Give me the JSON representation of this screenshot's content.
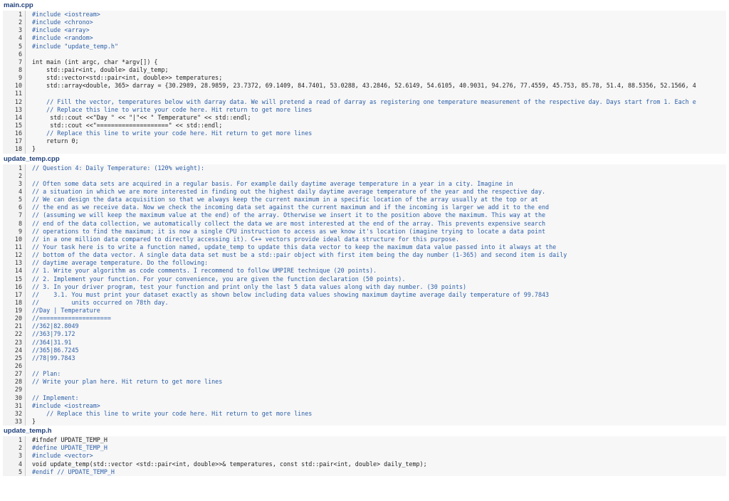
{
  "files": [
    {
      "name": "main.cpp",
      "lines": [
        {
          "n": "1",
          "text": "#include <iostream>",
          "kind": "pp"
        },
        {
          "n": "2",
          "text": "#include <chrono>",
          "kind": "pp"
        },
        {
          "n": "3",
          "text": "#include <array>",
          "kind": "pp"
        },
        {
          "n": "4",
          "text": "#include <random>",
          "kind": "pp"
        },
        {
          "n": "5",
          "text": "#include \"update_temp.h\"",
          "kind": "pp"
        },
        {
          "n": "6",
          "text": "",
          "kind": "plain"
        },
        {
          "n": "7",
          "text": "int main (int argc, char *argv[]) {",
          "kind": "plain"
        },
        {
          "n": "8",
          "text": "    std::pair<int, double> daily_temp;",
          "kind": "plain"
        },
        {
          "n": "9",
          "text": "    std::vector<std::pair<int, double>> temperatures;",
          "kind": "plain"
        },
        {
          "n": "10",
          "text": "    std::array<double, 365> darray = {30.2989, 28.9859, 23.7372, 69.1409, 84.7401, 53.0288, 43.2846, 52.6149, 54.6105, 40.9031, 94.276, 77.4559, 45.753, 85.78, 51.4, 88.5356, 52.1566, 4",
          "kind": "plain"
        },
        {
          "n": "11",
          "text": "",
          "kind": "plain"
        },
        {
          "n": "12",
          "text": "    // Fill the vector, temperatures below with darray data. We will pretend a read of darray as registering one temperature measurement of the respective day. Days start from 1. Each e",
          "kind": "cmt"
        },
        {
          "n": "13",
          "text": "    // Replace this line to write your code here. Hit return to get more lines",
          "kind": "cmt"
        },
        {
          "n": "14",
          "text": "     std::cout <<\"Day \" << \"|\"<< \" Temperature\" << std::endl;",
          "kind": "plain"
        },
        {
          "n": "15",
          "text": "     std::cout <<\"====================\" << std::endl;",
          "kind": "plain"
        },
        {
          "n": "16",
          "text": "    // Replace this line to write your code here. Hit return to get more lines",
          "kind": "cmt"
        },
        {
          "n": "17",
          "text": "    return 0;",
          "kind": "plain"
        },
        {
          "n": "18",
          "text": "}",
          "kind": "plain"
        }
      ]
    },
    {
      "name": "update_temp.cpp",
      "lines": [
        {
          "n": "1",
          "text": "// Question 4: Daily Temperature: (120% weight):",
          "kind": "cmt"
        },
        {
          "n": "2",
          "text": "",
          "kind": "plain"
        },
        {
          "n": "3",
          "text": "// Often some data sets are acquired in a regular basis. For example daily daytime average temperature in a year in a city. Imagine in",
          "kind": "cmt"
        },
        {
          "n": "4",
          "text": "// a situation in which we are more interested in finding out the highest daily daytime average temperature of the year and the respective day.",
          "kind": "cmt"
        },
        {
          "n": "5",
          "text": "// We can design the data acquisition so that we always keep the current maximum in a specific location of the array usually at the top or at",
          "kind": "cmt"
        },
        {
          "n": "6",
          "text": "// the end as we receive data. Now we check the incoming data set against the current maximum and if the incoming is larger we add it to the end",
          "kind": "cmt"
        },
        {
          "n": "7",
          "text": "// (assuming we will keep the maximum value at the end) of the array. Otherwise we insert it to the position above the maximum. This way at the",
          "kind": "cmt"
        },
        {
          "n": "8",
          "text": "// end of the data collection, we automatically collect the data we are most interested at the end of the array. This prevents expensive search",
          "kind": "cmt"
        },
        {
          "n": "9",
          "text": "// operations to find the maximum; it is now a single CPU instruction to access as we know it's location (imagine trying to locate a data point",
          "kind": "cmt"
        },
        {
          "n": "10",
          "text": "// in a one million data compared to directly accessing it). C++ vectors provide ideal data structure for this purpose.",
          "kind": "cmt"
        },
        {
          "n": "11",
          "text": "// Your task here is to write a function named, update_temp to update this data vector to keep the maximum data value passed into it always at the",
          "kind": "cmt"
        },
        {
          "n": "12",
          "text": "// bottom of the data vector. A single data data set must be a std::pair object with first item being the day number (1-365) and second item is daily",
          "kind": "cmt"
        },
        {
          "n": "13",
          "text": "// daytime average temperature. Do the following:",
          "kind": "cmt"
        },
        {
          "n": "14",
          "text": "// 1. Write your algorithm as code comments. I recommend to follow UMPIRE technique (20 points).",
          "kind": "cmt"
        },
        {
          "n": "15",
          "text": "// 2. Implement your function. For your convenience, you are given the function declaration (50 points).",
          "kind": "cmt"
        },
        {
          "n": "16",
          "text": "// 3. In your driver program, test your function and print only the last 5 data values along with day number. (30 points)",
          "kind": "cmt"
        },
        {
          "n": "17",
          "text": "//    3.1. You must print your dataset exactly as shown below including data values showing maximum daytime average daily temperature of 99.7843",
          "kind": "cmt"
        },
        {
          "n": "18",
          "text": "//         units occurred on 78th day.",
          "kind": "cmt"
        },
        {
          "n": "19",
          "text": "//Day | Temperature",
          "kind": "cmt"
        },
        {
          "n": "20",
          "text": "//====================",
          "kind": "cmt"
        },
        {
          "n": "21",
          "text": "//362|82.8049",
          "kind": "cmt"
        },
        {
          "n": "22",
          "text": "//363|79.172",
          "kind": "cmt"
        },
        {
          "n": "23",
          "text": "//364|31.91",
          "kind": "cmt"
        },
        {
          "n": "24",
          "text": "//365|86.7245",
          "kind": "cmt"
        },
        {
          "n": "25",
          "text": "//78|99.7843",
          "kind": "cmt"
        },
        {
          "n": "26",
          "text": "",
          "kind": "plain"
        },
        {
          "n": "27",
          "text": "// Plan:",
          "kind": "cmt"
        },
        {
          "n": "28",
          "text": "// Write your plan here. Hit return to get more lines",
          "kind": "cmt"
        },
        {
          "n": "29",
          "text": "",
          "kind": "plain"
        },
        {
          "n": "30",
          "text": "// Implement:",
          "kind": "cmt"
        },
        {
          "n": "31",
          "text": "#include <iostream>",
          "kind": "pp"
        },
        {
          "n": "32",
          "text": "    // Replace this line to write your code here. Hit return to get more lines",
          "kind": "cmt"
        },
        {
          "n": "33",
          "text": "}",
          "kind": "plain"
        }
      ]
    },
    {
      "name": "update_temp.h",
      "lines": [
        {
          "n": "1",
          "text": "#ifndef UPDATE_TEMP_H",
          "kind": "plain"
        },
        {
          "n": "2",
          "text": "#define UPDATE_TEMP_H",
          "kind": "pp"
        },
        {
          "n": "3",
          "text": "#include <vector>",
          "kind": "pp"
        },
        {
          "n": "4",
          "text": "void update_temp(std::vector <std::pair<int, double>>& temperatures, const std::pair<int, double> daily_temp);",
          "kind": "plain"
        },
        {
          "n": "5",
          "text": "#endif // UPDATE_TEMP_H",
          "kind": "pp"
        }
      ]
    }
  ]
}
